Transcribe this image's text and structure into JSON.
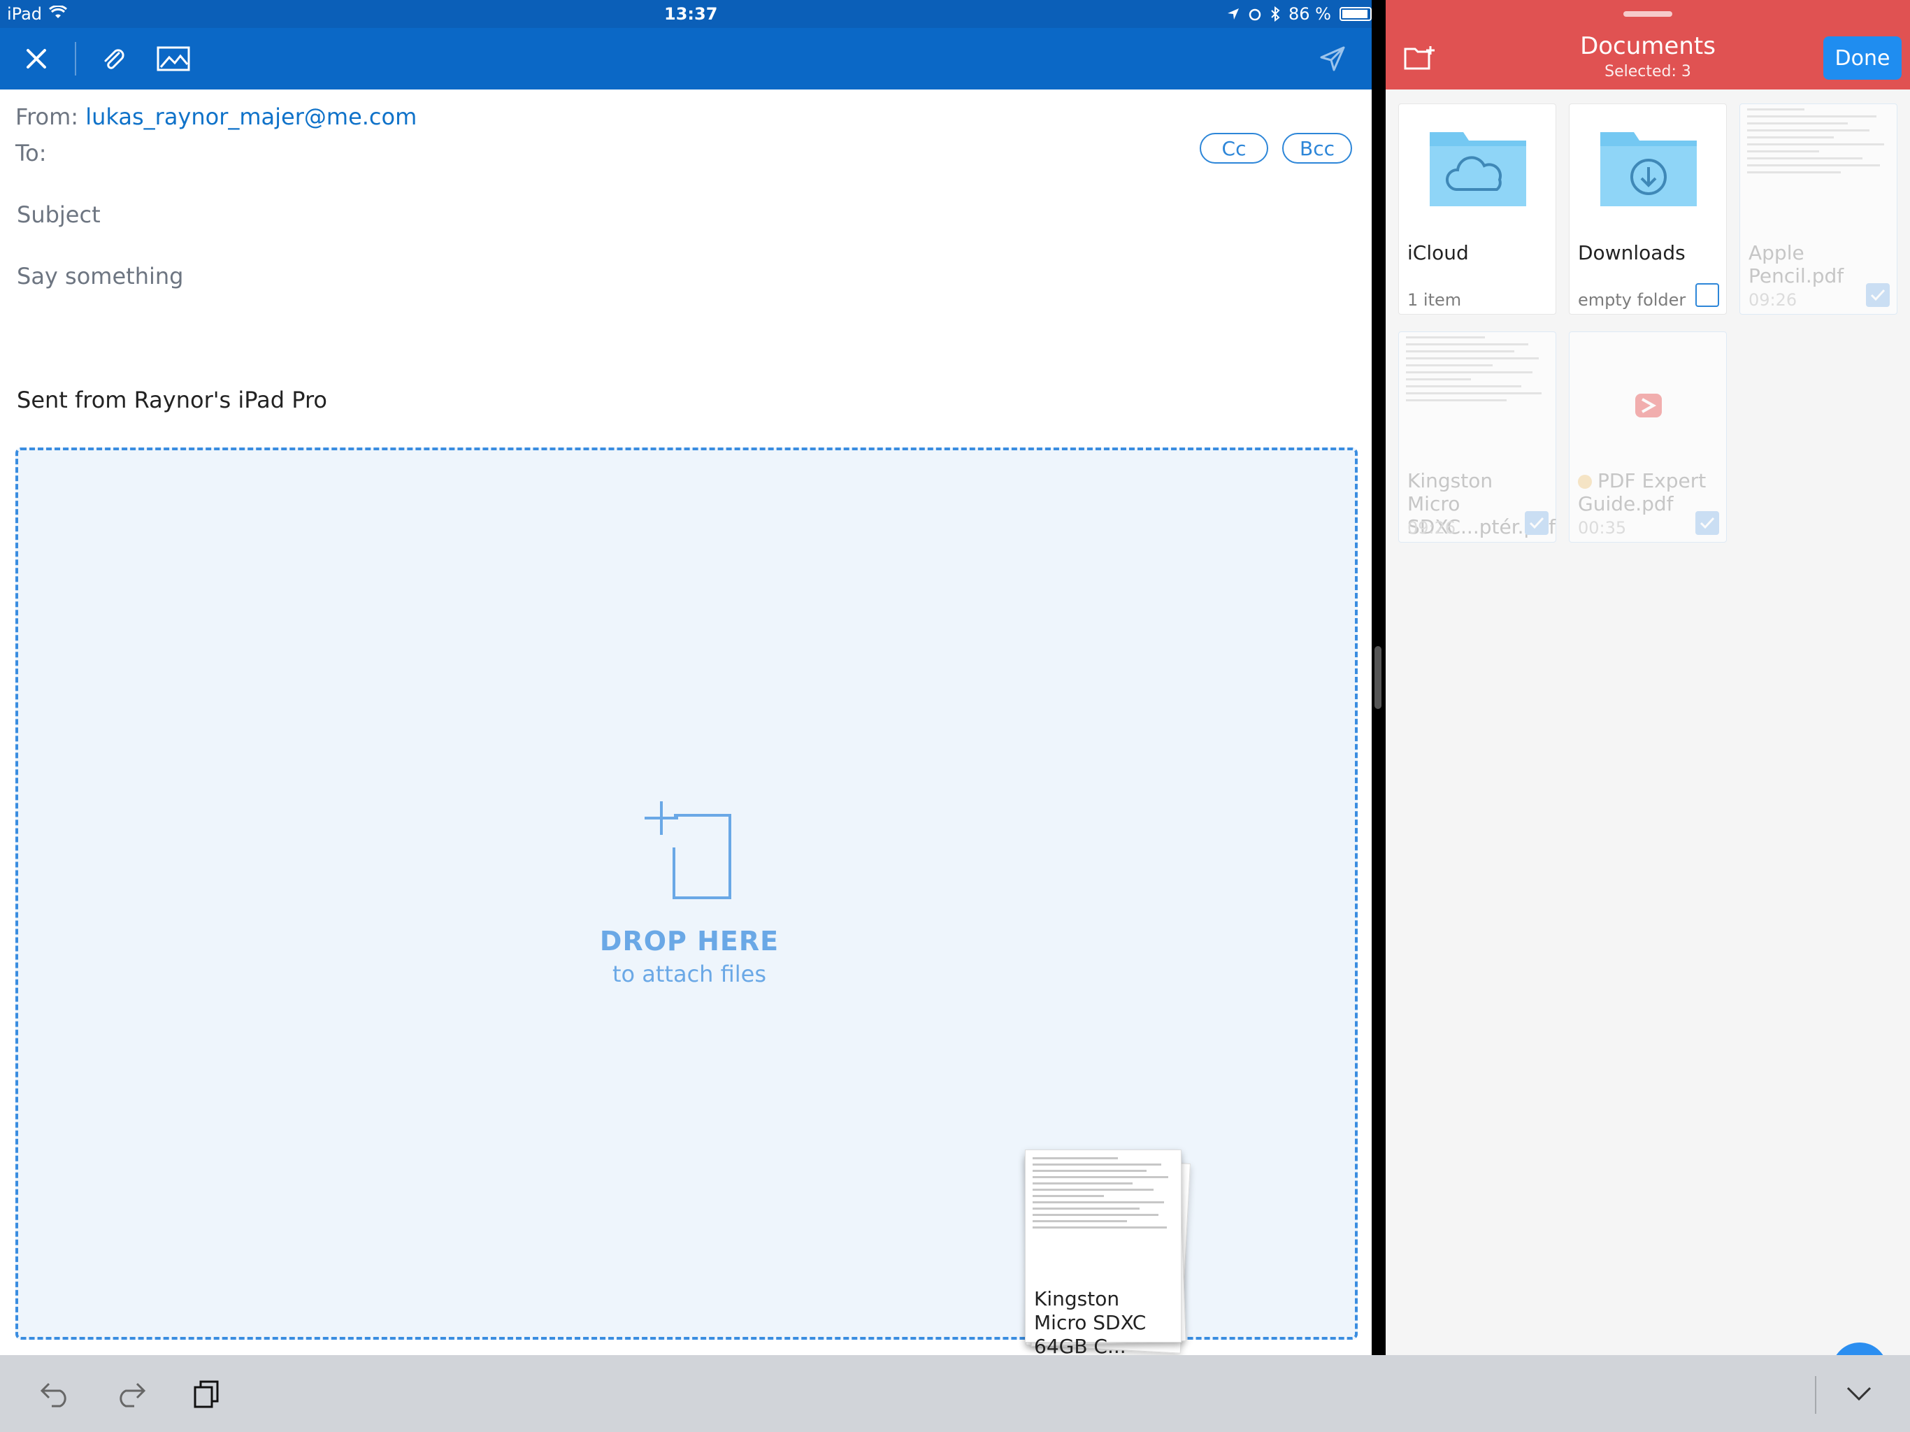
{
  "status_bar": {
    "device": "iPad",
    "time": "13:37",
    "battery": "86 %"
  },
  "compose": {
    "from_label": "From:",
    "from_address": "lukas_raynor_majer@me.com",
    "to_label": "To:",
    "cc_label": "Cc",
    "bcc_label": "Bcc",
    "subject_placeholder": "Subject",
    "body_placeholder": "Say something",
    "signature": "Sent from Raynor's iPad Pro"
  },
  "dropzone": {
    "title": "DROP HERE",
    "subtitle": "to attach files"
  },
  "drag_item": {
    "label": "Kingston Micro SDXC 64GB C..."
  },
  "documents": {
    "title": "Documents",
    "subtitle": "Selected: 3",
    "done_label": "Done",
    "items": [
      {
        "name": "iCloud",
        "meta": "1 item",
        "kind": "folder",
        "icon": "cloud-icon"
      },
      {
        "name": "Downloads",
        "meta": "empty folder",
        "kind": "folder",
        "icon": "download-icon",
        "selected": false
      },
      {
        "name": "Apple Pencil.pdf",
        "meta": "09:26",
        "kind": "pdf",
        "selected": true
      },
      {
        "name": "Kingston Micro SDXC...ptér.pdf",
        "meta": "09:26",
        "kind": "pdf",
        "selected": true
      },
      {
        "name": "PDF Expert Guide.pdf",
        "meta": "00:35",
        "kind": "pdf",
        "selected": true
      }
    ]
  },
  "colors": {
    "mail_toolbar": "#0b68c6",
    "documents_header": "#e05252",
    "accent_blue": "#2d86d8"
  }
}
